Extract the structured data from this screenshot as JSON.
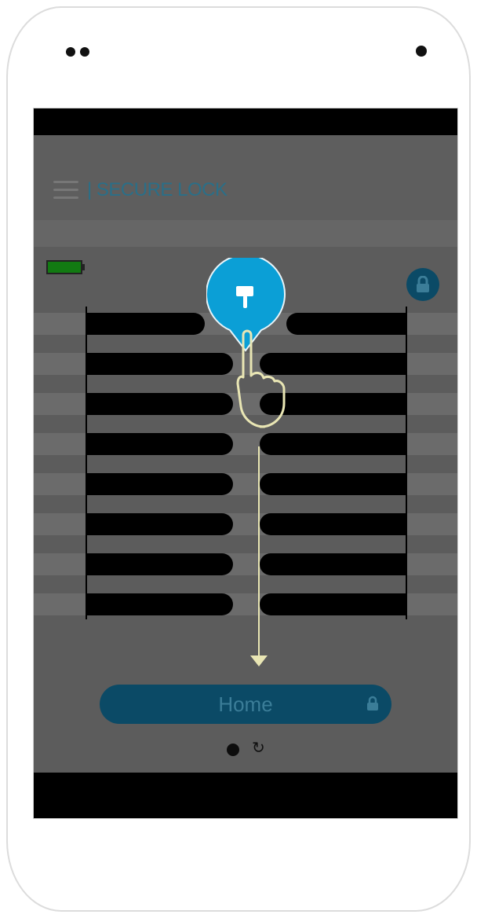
{
  "app": {
    "title": "| SECURE LOCK",
    "home_label": "Home"
  },
  "icons": {
    "menu": "hamburger-icon",
    "battery": "battery-full-icon",
    "lock": "padlock-icon",
    "refresh": "refresh-icon",
    "hint": "pointing-hand-icon"
  },
  "colors": {
    "accent": "#0b9fd6",
    "accent_dark": "#0b4a66",
    "battery": "#127a12",
    "guide": "#e9e6b4"
  },
  "page_indicator": {
    "pages": 2,
    "current": 1
  }
}
